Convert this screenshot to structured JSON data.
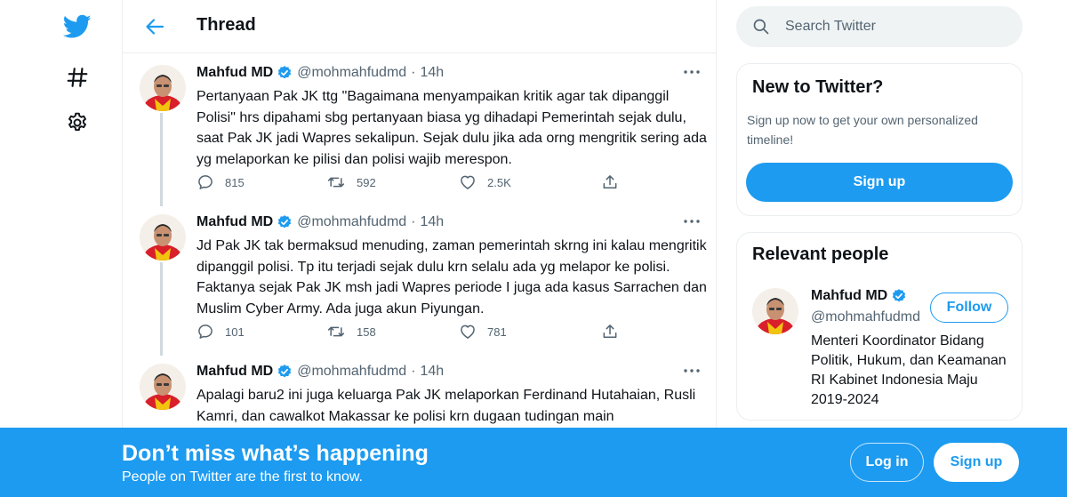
{
  "header": {
    "title": "Thread"
  },
  "tweets": [
    {
      "name": "Mahfud MD",
      "handle": "@mohmahfudmd",
      "dot": "·",
      "time": "14h",
      "text": "Pertanyaan Pak JK ttg \"Bagaimana menyampaikan kritik agar tak dipanggil Polisi\" hrs dipahami sbg pertanyaan biasa yg dihadapi Pemerintah sejak dulu, saat Pak JK jadi Wapres sekalipun. Sejak dulu jika ada orng mengritik sering ada yg melaporkan ke pilisi dan polisi wajib merespon.",
      "replies": "815",
      "retweets": "592",
      "likes": "2.5K"
    },
    {
      "name": "Mahfud MD",
      "handle": "@mohmahfudmd",
      "dot": "·",
      "time": "14h",
      "text": "Jd Pak JK tak bermaksud menuding, zaman pemerintah skrng ini kalau mengritik dipanggil polisi. Tp itu terjadi sejak dulu krn selalu ada yg melapor ke polisi. Faktanya sejak Pak JK msh jadi Wapres periode I juga ada kasus Sarrachen dan Muslim Cyber Army. Ada juga akun Piyungan.",
      "replies": "101",
      "retweets": "158",
      "likes": "781"
    },
    {
      "name": "Mahfud MD",
      "handle": "@mohmahfudmd",
      "dot": "·",
      "time": "14h",
      "text": "Apalagi baru2 ini juga keluarga Pak JK melaporkan Ferdinand Hutahaian, Rusli Kamri, dan cawalkot Makassar ke polisi krn dugaan tudingan main"
    }
  ],
  "search": {
    "placeholder": "Search Twitter"
  },
  "new_to_twitter": {
    "title": "New to Twitter?",
    "desc": "Sign up now to get your own personalized timeline!",
    "button": "Sign up"
  },
  "relevant_people": {
    "title": "Relevant people",
    "name": "Mahfud MD",
    "handle": "@mohmahfudmd",
    "follow": "Follow",
    "bio": "Menteri Koordinator Bidang Politik, Hukum, dan Keamanan RI Kabinet Indonesia Maju 2019-2024"
  },
  "banner": {
    "title": "Don’t miss what’s happening",
    "subtitle": "People on Twitter are the first to know.",
    "login": "Log in",
    "signup": "Sign up"
  },
  "colors": {
    "accent": "#1d9bf0",
    "text": "#0f1419",
    "secondary": "#536471",
    "border": "#ebeef0"
  },
  "icons": {
    "logo": "twitter-bird-icon",
    "explore": "hashtag-icon",
    "settings": "gear-icon",
    "back": "arrow-left-icon",
    "search": "search-icon",
    "verified": "verified-badge-icon",
    "reply": "reply-icon",
    "retweet": "retweet-icon",
    "like": "heart-icon",
    "share": "share-icon",
    "more": "more-icon"
  }
}
